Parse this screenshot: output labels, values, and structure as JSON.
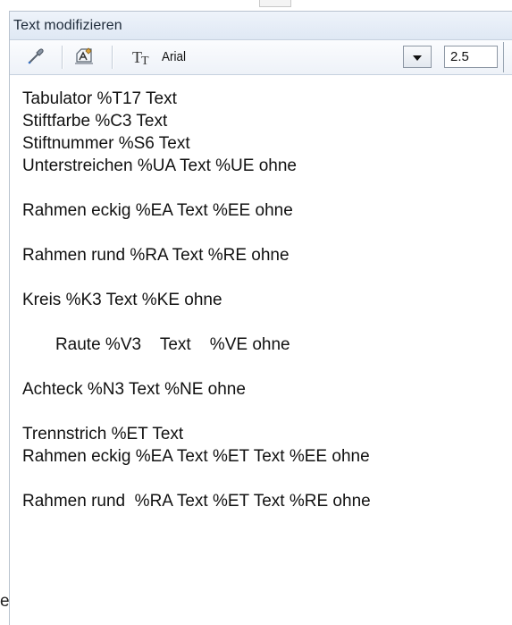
{
  "window": {
    "title": "Text modifizieren"
  },
  "toolbar": {
    "font_name": "Arial",
    "font_size": "2.5",
    "icons": [
      "eyedropper-icon",
      "text-parameters-icon",
      "font-type-icon",
      "chevron-down-icon"
    ]
  },
  "outside": {
    "stray_char": "e"
  },
  "text_lines": [
    "Tabulator %T17 Text",
    "Stiftfarbe %C3 Text",
    "Stiftnummer %S6 Text",
    "Unterstreichen %UA Text %UE ohne",
    "",
    "Rahmen eckig %EA Text %EE ohne",
    "",
    "Rahmen rund %RA Text %RE ohne",
    "",
    "Kreis %K3 Text %KE ohne",
    "",
    "       Raute %V3    Text    %VE ohne",
    "",
    "Achteck %N3 Text %NE ohne",
    "",
    "Trennstrich %ET Text",
    "Rahmen eckig %EA Text %ET Text %EE ohne",
    "",
    "Rahmen rund  %RA Text %ET Text %RE ohne"
  ]
}
